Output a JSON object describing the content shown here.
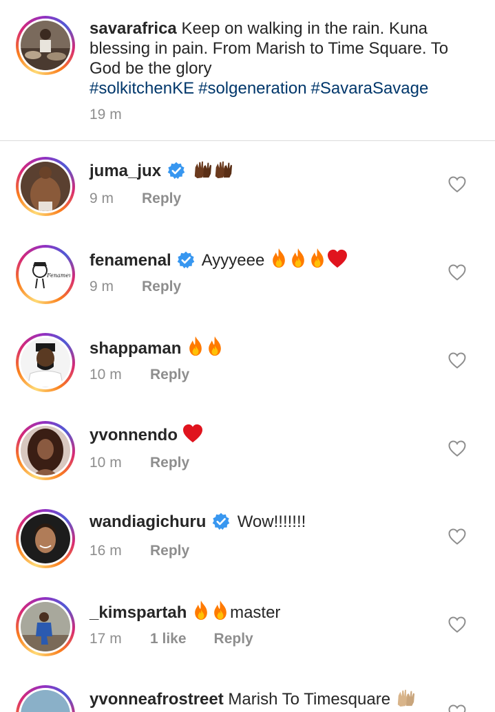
{
  "caption": {
    "username": "savarafrica",
    "text": "Keep on walking in the rain. Kuna blessing in pain. From Marish to Time Square. To God be the glory",
    "hashtags": [
      "#solkitchenKE",
      "#solgeneration",
      "#SavaraSavage"
    ],
    "time": "19 m"
  },
  "comments": [
    {
      "username": "juma_jux",
      "verified": true,
      "text": "",
      "emojis": "hands-dark",
      "time": "9 m",
      "reply": "Reply"
    },
    {
      "username": "fenamenal",
      "verified": true,
      "text": "Ayyyeee",
      "emojis": "fire-fire-fire-heart",
      "time": "9 m",
      "reply": "Reply"
    },
    {
      "username": "shappaman",
      "verified": false,
      "text": "",
      "emojis": "fire-fire",
      "time": "10 m",
      "reply": "Reply"
    },
    {
      "username": "yvonnendo",
      "verified": false,
      "text": "",
      "emojis": "heart",
      "time": "10 m",
      "reply": "Reply"
    },
    {
      "username": "wandiagichuru",
      "verified": true,
      "text": "Wow!!!!!!!",
      "emojis": "",
      "time": "16 m",
      "reply": "Reply"
    },
    {
      "username": "_kimspartah",
      "verified": false,
      "text": "master",
      "emojis": "fire-fire",
      "time": "17 m",
      "likes": "1 like",
      "reply": "Reply"
    },
    {
      "username": "yvonneafrostreet",
      "verified": false,
      "text": "Marish To Timesquare",
      "emojis": "hands-light"
    }
  ],
  "icons": {
    "verified": "verified-badge-icon",
    "like": "heart-outline-icon"
  },
  "colors": {
    "hashtag": "#00376b",
    "verified": "#3897f0",
    "meta": "#8e8e8e",
    "fire": "#ff7a00",
    "heart": "#e0141e"
  }
}
